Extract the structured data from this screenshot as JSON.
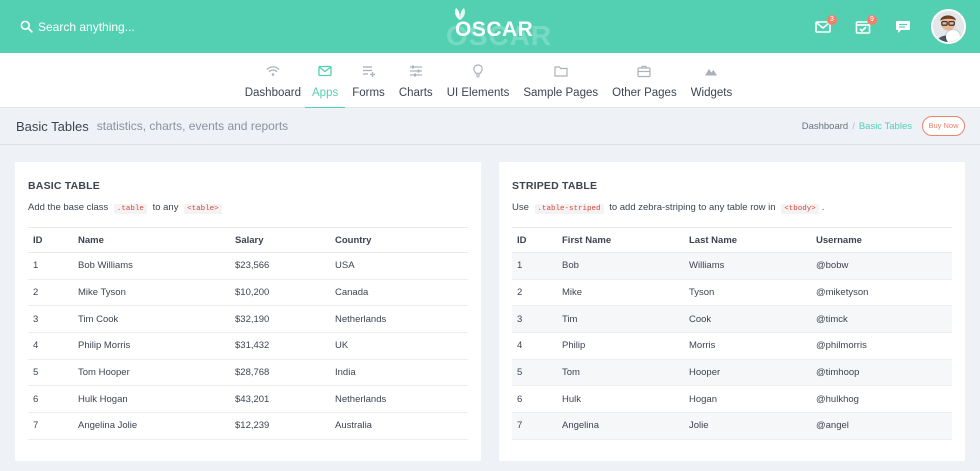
{
  "search": {
    "placeholder": "Search anything..."
  },
  "brand": {
    "logo_text": "OSCAR"
  },
  "header": {
    "mail_badge": "3",
    "tasks_badge": "9"
  },
  "nav": [
    {
      "label": "Dashboard",
      "icon": "wifi-icon"
    },
    {
      "label": "Apps",
      "icon": "mail-icon"
    },
    {
      "label": "Forms",
      "icon": "list-plus-icon"
    },
    {
      "label": "Charts",
      "icon": "sliders-icon"
    },
    {
      "label": "UI Elements",
      "icon": "lightbulb-icon"
    },
    {
      "label": "Sample Pages",
      "icon": "folder-icon"
    },
    {
      "label": "Other Pages",
      "icon": "briefcase-icon"
    },
    {
      "label": "Widgets",
      "icon": "mountain-icon"
    }
  ],
  "page": {
    "title": "Basic Tables",
    "subtitle": "statistics, charts, events and reports"
  },
  "breadcrumb": {
    "home": "Dashboard",
    "sep": "/",
    "current": "Basic Tables",
    "buy_label": "Buy Now"
  },
  "basic": {
    "title": "BASIC TABLE",
    "desc_pre": "Add the base class",
    "code1": ".table",
    "desc_mid": "to any",
    "code2": "<table>",
    "headers": [
      "ID",
      "Name",
      "Salary",
      "Country"
    ],
    "rows": [
      [
        "1",
        "Bob Williams",
        "$23,566",
        "USA"
      ],
      [
        "2",
        "Mike Tyson",
        "$10,200",
        "Canada"
      ],
      [
        "3",
        "Tim Cook",
        "$32,190",
        "Netherlands"
      ],
      [
        "4",
        "Philip Morris",
        "$31,432",
        "UK"
      ],
      [
        "5",
        "Tom Hooper",
        "$28,768",
        "India"
      ],
      [
        "6",
        "Hulk Hogan",
        "$43,201",
        "Netherlands"
      ],
      [
        "7",
        "Angelina Jolie",
        "$12,239",
        "Australia"
      ]
    ]
  },
  "striped": {
    "title": "STRIPED TABLE",
    "desc_pre": "Use",
    "code1": ".table-striped",
    "desc_mid": "to add zebra-striping to any table row in",
    "code2": "<tbody>",
    "desc_post": ".",
    "headers": [
      "ID",
      "First Name",
      "Last Name",
      "Username"
    ],
    "rows": [
      [
        "1",
        "Bob",
        "Williams",
        "@bobw"
      ],
      [
        "2",
        "Mike",
        "Tyson",
        "@miketyson"
      ],
      [
        "3",
        "Tim",
        "Cook",
        "@timck"
      ],
      [
        "4",
        "Philip",
        "Morris",
        "@philmorris"
      ],
      [
        "5",
        "Tom",
        "Hooper",
        "@timhoop"
      ],
      [
        "6",
        "Hulk",
        "Hogan",
        "@hulkhog"
      ],
      [
        "7",
        "Angelina",
        "Jolie",
        "@angel"
      ]
    ]
  },
  "colors": {
    "accent": "#53d0b2",
    "badge": "#f0826b",
    "code": "#d3493a"
  }
}
